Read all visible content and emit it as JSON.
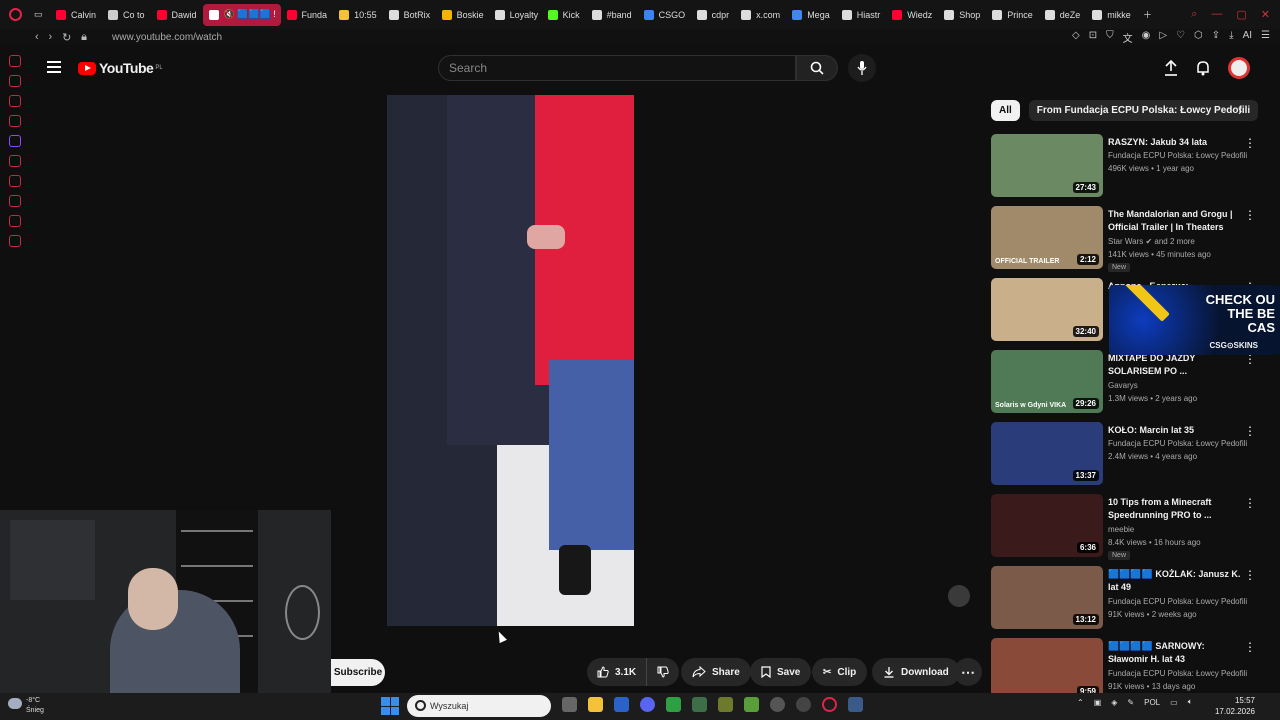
{
  "browser": {
    "tabs": [
      {
        "label": "Calvin",
        "color": "#ff0033"
      },
      {
        "label": "Co to",
        "color": "#cccccc"
      },
      {
        "label": "Dawid",
        "color": "#ff0033"
      },
      {
        "label": "🔇 🟦🟦🟦 !",
        "color": "#ffffff",
        "active": true
      },
      {
        "label": "Funda",
        "color": "#ff0033"
      },
      {
        "label": "10:55",
        "color": "#f4c430"
      },
      {
        "label": "BotRix",
        "color": "#dddddd"
      },
      {
        "label": "Boskie",
        "color": "#f4b400"
      },
      {
        "label": "Loyalty",
        "color": "#dddddd"
      },
      {
        "label": "Kick",
        "color": "#53fc18"
      },
      {
        "label": "#band",
        "color": "#dddddd"
      },
      {
        "label": "CSGO",
        "color": "#3b82f6"
      },
      {
        "label": "cdpr",
        "color": "#dddddd"
      },
      {
        "label": "x.com",
        "color": "#dddddd"
      },
      {
        "label": "Mega",
        "color": "#4285f4"
      },
      {
        "label": "Hiastr",
        "color": "#dddddd"
      },
      {
        "label": "Wiedz",
        "color": "#ff0033"
      },
      {
        "label": "Shop",
        "color": "#dddddd"
      },
      {
        "label": "Prince",
        "color": "#dddddd"
      },
      {
        "label": "deZe",
        "color": "#dddddd"
      },
      {
        "label": "mikke",
        "color": "#dddddd"
      }
    ],
    "url": "www.youtube.com/watch",
    "ext_label": "AI"
  },
  "youtube": {
    "logo_text": "YouTube",
    "region": "PL",
    "search_placeholder": "Search"
  },
  "actions": {
    "subscribe": "Subscribe",
    "likes": "3.1K",
    "share": "Share",
    "save": "Save",
    "clip": "Clip",
    "download": "Download"
  },
  "chips": [
    {
      "label": "All",
      "active": true
    },
    {
      "label": "From Fundacja ECPU Polska: Łowcy Pedofili",
      "active": false
    }
  ],
  "recommendations": [
    {
      "title": "RASZYN: Jakub 34 lata",
      "channel": "Fundacja ECPU Polska: Łowcy Pedofili",
      "meta": "496K views • 1 year ago",
      "duration": "27:43",
      "thumb_color": "#6b8a63"
    },
    {
      "title": "The Mandalorian and Grogu | Official Trailer | In Theaters Ma...",
      "channel": "Star Wars ✔ and 2 more",
      "meta": "141K views • 45 minutes ago",
      "duration": "2:12",
      "badge": "OFFICIAL TRAILER",
      "new": "New",
      "thumb_color": "#a08a6a"
    },
    {
      "title": "Аврора - Берегись",
      "channel": "",
      "meta": "",
      "duration": "32:40",
      "thumb_color": "#c9b08a"
    },
    {
      "title": "MIXTAPE DO JAZDY SOLARISEM PO ...",
      "channel": "Gavarys",
      "meta": "1.3M views • 2 years ago",
      "duration": "29:26",
      "badge": "Solaris w Gdyni VIKA",
      "thumb_color": "#4f7a55"
    },
    {
      "title": "KOŁO: Marcin lat 35",
      "channel": "Fundacja ECPU Polska: Łowcy Pedofili",
      "meta": "2.4M views • 4 years ago",
      "duration": "13:37",
      "thumb_color": "#2a3d7a"
    },
    {
      "title": "10 Tips from a Minecraft Speedrunning PRO to ...",
      "channel": "meebie",
      "meta": "8.4K views • 16 hours ago",
      "duration": "6:36",
      "new": "New",
      "thumb_color": "#3a1a1a"
    },
    {
      "title": "🟦🟦🟦🟦 KOŻLAK: Janusz K. lat 49",
      "channel": "Fundacja ECPU Polska: Łowcy Pedofili",
      "meta": "91K views • 2 weeks ago",
      "duration": "13:12",
      "thumb_color": "#7b5a4a"
    },
    {
      "title": "🟦🟦🟦🟦 SARNOWY: Sławomir H. lat 43",
      "channel": "Fundacja ECPU Polska: Łowcy Pedofili",
      "meta": "91K views • 13 days ago",
      "duration": "9:59",
      "thumb_color": "#8a4a3a"
    }
  ],
  "ad": {
    "text_line1": "CHECK OU",
    "text_line2": "THE BE",
    "text_line3": "CAS",
    "brand": "CSG⊙SKINS"
  },
  "taskbar": {
    "temp": "-8°C",
    "weather": "Śnieg",
    "search_placeholder": "Wyszukaj",
    "lang": "POL",
    "time": "15:57",
    "date": "17.02.2026"
  }
}
